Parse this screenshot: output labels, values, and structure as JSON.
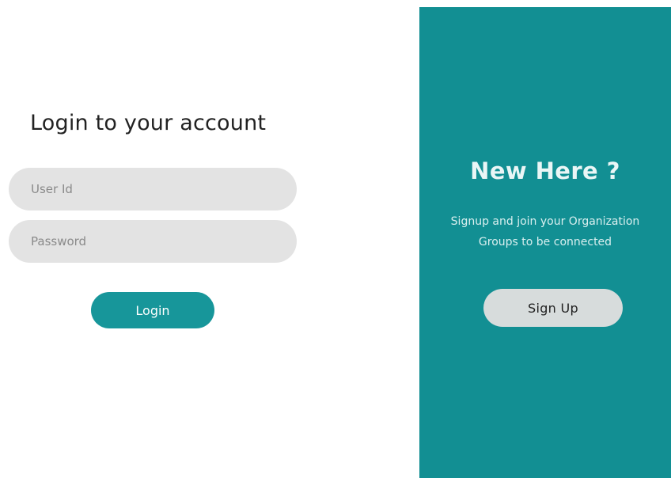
{
  "login": {
    "title": "Login to your account",
    "user_id_placeholder": "User Id",
    "user_id_value": "",
    "password_placeholder": "Password",
    "password_value": "",
    "login_label": "Login"
  },
  "signup": {
    "title": "New Here ?",
    "text_line1": "Signup and join your Organization",
    "text_line2": "Groups to be connected",
    "button_label": "Sign Up"
  },
  "colors": {
    "accent": "#17969a",
    "panel_background": "#128f93",
    "input_background": "#e3e3e3",
    "signup_button_background": "#d7dcdc"
  }
}
